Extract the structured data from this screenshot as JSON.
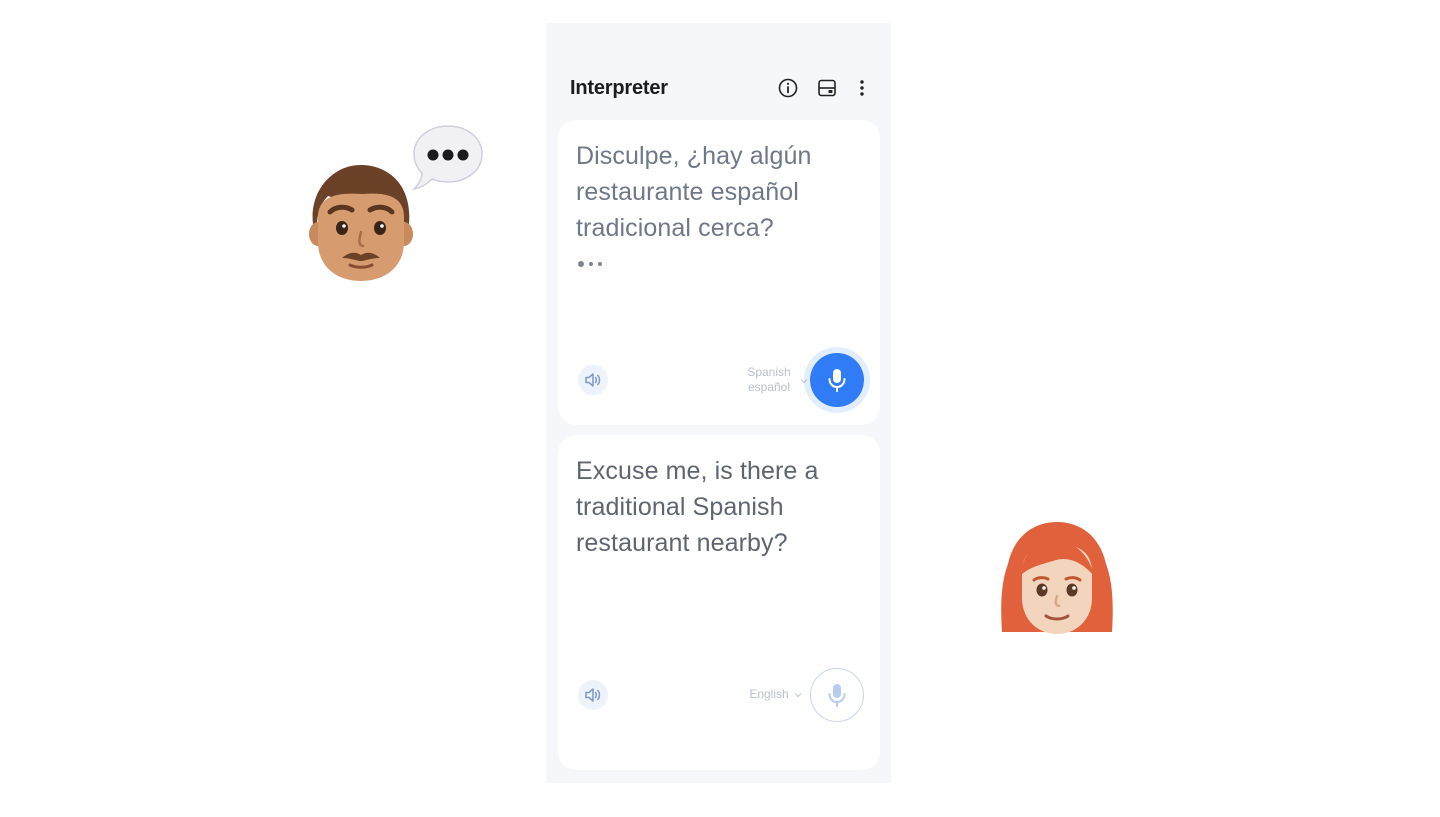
{
  "header": {
    "title": "Interpreter"
  },
  "top_panel": {
    "text": "Disculpe, ¿hay algún restaurante español tradicional cerca?",
    "language_name": "Spanish",
    "language_native": "español"
  },
  "bottom_panel": {
    "text": "Excuse me, is there a traditional Spanish restaurant nearby?",
    "language_name": "English"
  },
  "icons": {
    "info": "info-icon",
    "layout": "split-view-icon",
    "more": "more-vertical-icon",
    "speaker": "speaker-icon",
    "mic": "microphone-icon",
    "chevron": "chevron-down-icon"
  },
  "colors": {
    "accent": "#2f7cf6",
    "background": "#f6f7fa",
    "panel": "#ffffff"
  }
}
